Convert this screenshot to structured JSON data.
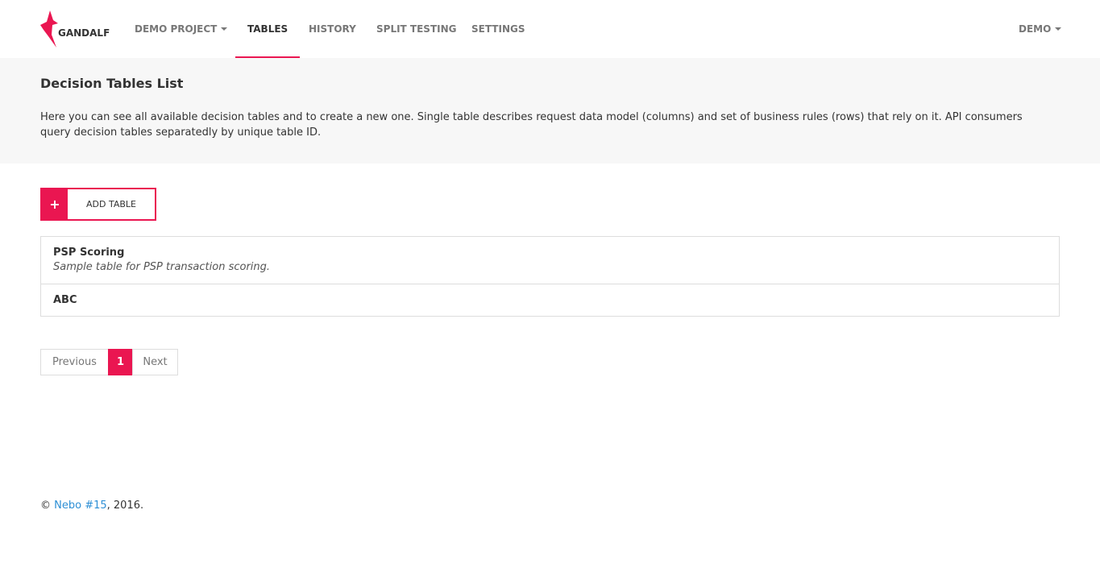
{
  "brand": {
    "name": "GANDALF",
    "logo_icon": "gandalf-logo-icon",
    "accent": "#ea1651"
  },
  "nav": {
    "project": "DEMO PROJECT",
    "tables": "TABLES",
    "history": "HISTORY",
    "split_testing": "SPLIT TESTING",
    "settings": "SETTINGS",
    "user": "DEMO",
    "active": "TABLES"
  },
  "header": {
    "title": "Decision Tables List",
    "description": "Here you can see all available decision tables and to create a new one. Single table describes request data model (columns) and set of business rules (rows) that rely on it. API consumers query decision tables separatedly by unique table ID."
  },
  "add_button": {
    "icon": "plus-icon",
    "symbol": "+",
    "label": "ADD TABLE"
  },
  "tables": [
    {
      "title": "PSP Scoring",
      "description": "Sample table for PSP transaction scoring."
    },
    {
      "title": "ABC",
      "description": ""
    }
  ],
  "pagination": {
    "previous": "Previous",
    "current": "1",
    "next": "Next"
  },
  "footer": {
    "copyright": "©",
    "link_text": "Nebo #15",
    "year_text": ", 2016."
  }
}
